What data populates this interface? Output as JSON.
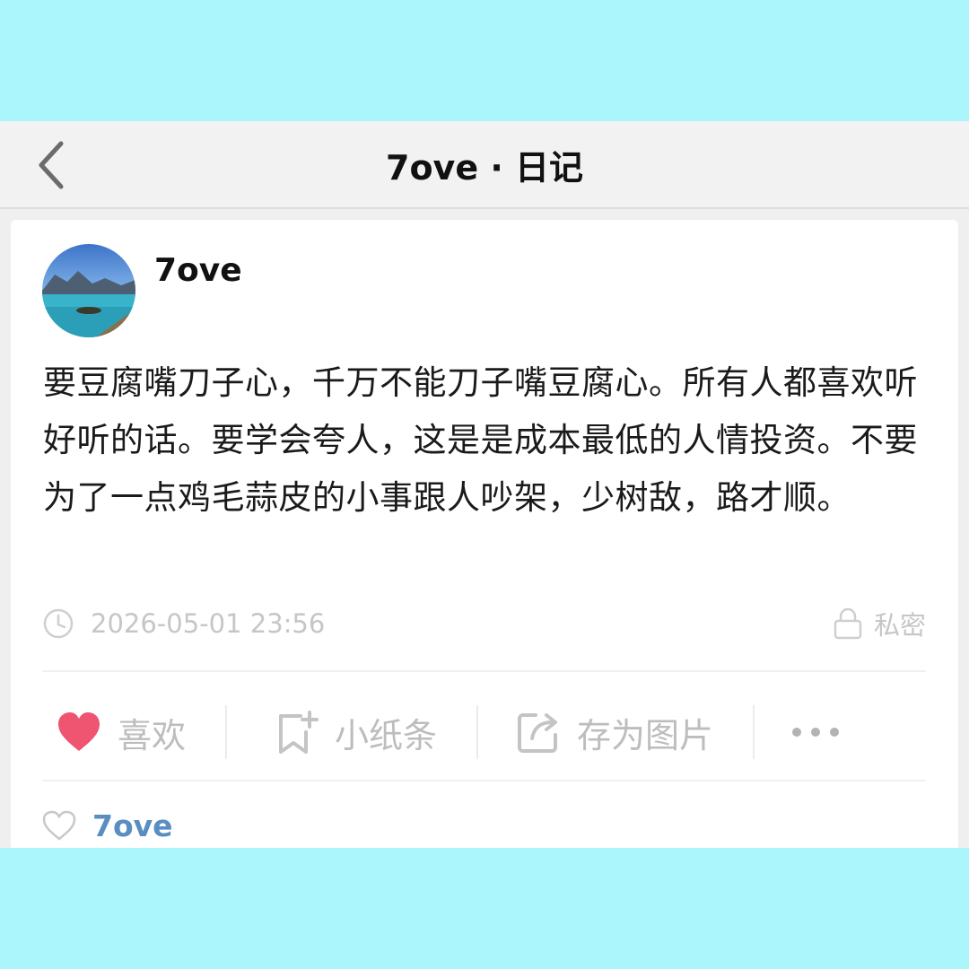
{
  "header": {
    "title": "7ove · 日记"
  },
  "post": {
    "author": "7ove",
    "text": "要豆腐嘴刀子心，千万不能刀子嘴豆腐心。所有人都喜欢听好听的话。要学会夸人，这是是成本最低的人情投资。不要为了一点鸡毛蒜皮的小事跟人吵架，少树敌，路才顺。",
    "timestamp": "2026-05-01 23:56",
    "privacy": "私密"
  },
  "actions": {
    "like": "喜欢",
    "note": "小纸条",
    "save_image": "存为图片"
  },
  "likes": {
    "users": [
      "7ove"
    ]
  },
  "colors": {
    "background": "#aaf6fc",
    "like_heart": "#ef5470",
    "liker_name": "#5a8dc0",
    "muted": "#c6c6c6"
  },
  "icons": [
    "back-arrow-icon",
    "clock-icon",
    "lock-icon",
    "heart-icon",
    "bookmark-plus-icon",
    "share-icon",
    "more-icon",
    "heart-outline-icon"
  ]
}
